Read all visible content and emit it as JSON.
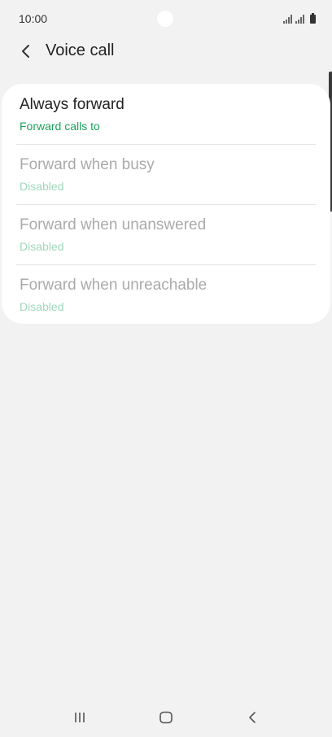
{
  "status_bar": {
    "time": "10:00"
  },
  "header": {
    "title": "Voice call",
    "back_icon": "chevron-left-icon"
  },
  "forwarding_options": [
    {
      "title": "Always forward",
      "summary": "Forward calls to",
      "enabled": true
    },
    {
      "title": "Forward when busy",
      "summary": "Disabled",
      "enabled": false
    },
    {
      "title": "Forward when unanswered",
      "summary": "Disabled",
      "enabled": false
    },
    {
      "title": "Forward when unreachable",
      "summary": "Disabled",
      "enabled": false
    }
  ],
  "navigation_bar": {
    "recent_icon": "recent-apps-icon",
    "home_icon": "home-icon",
    "back_icon": "back-icon"
  },
  "colors": {
    "accent_green": "#1aa35b",
    "disabled_green": "#9fd8bb",
    "background": "#f2f2f2",
    "card": "#ffffff"
  }
}
